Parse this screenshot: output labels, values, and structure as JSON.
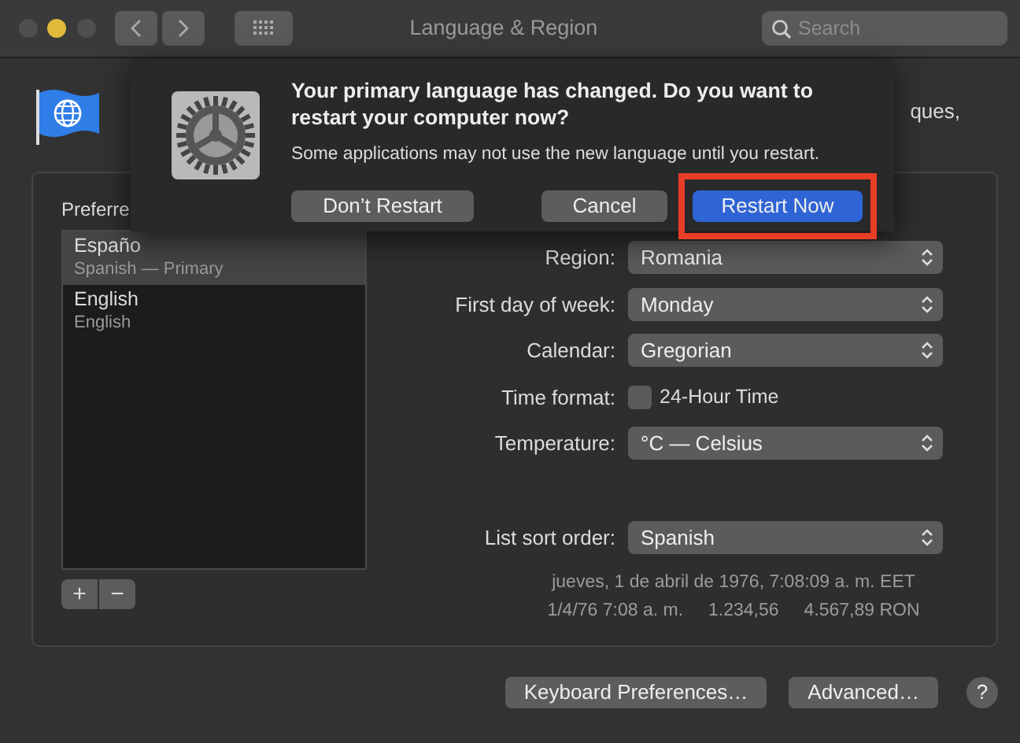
{
  "window": {
    "title": "Language & Region",
    "traffic_lights": [
      {
        "color": "#4f4f4f"
      },
      {
        "color": "#e2b83b"
      },
      {
        "color": "#4f4f4f"
      }
    ],
    "search": {
      "placeholder": "Search"
    }
  },
  "header": {
    "text_fragment": "ques,"
  },
  "preferred_languages": {
    "label": "Preferre",
    "items": [
      {
        "name": "Españo",
        "detail": "Spanish — Primary",
        "selected": true
      },
      {
        "name": "English",
        "detail": "English",
        "selected": false
      }
    ],
    "buttons": [
      "+",
      "−"
    ]
  },
  "settings": [
    {
      "kind": "select",
      "label": "Region:",
      "value": "Romania"
    },
    {
      "kind": "select",
      "label": "First day of week:",
      "value": "Monday"
    },
    {
      "kind": "select",
      "label": "Calendar:",
      "value": "Gregorian"
    },
    {
      "kind": "checkbox",
      "label": "Time format:",
      "value": "24-Hour Time",
      "checked": false
    },
    {
      "kind": "select",
      "label": "Temperature:",
      "value": "°C — Celsius"
    }
  ],
  "list_sort_order": {
    "label": "List sort order:",
    "value": "Spanish"
  },
  "sample": {
    "long_date": "jueves, 1 de abril de 1976, 7:08:09 a. m. EET",
    "short_date": "1/4/76 7:08 a. m.",
    "number": "1.234,56",
    "currency": "4.567,89 RON"
  },
  "buttons": [
    "Keyboard Preferences…",
    "Advanced…"
  ],
  "help": "?",
  "dialog": {
    "title": "Your primary language has changed. Do you want to restart your computer now?",
    "message": "Some applications may not use the new language until you restart.",
    "buttons": [
      {
        "label": "Don’t Restart",
        "kind": "secondary",
        "highlighted": false
      },
      {
        "label": "Cancel",
        "kind": "secondary",
        "highlighted": false
      },
      {
        "label": "Restart Now",
        "kind": "default",
        "highlighted": true
      }
    ]
  }
}
